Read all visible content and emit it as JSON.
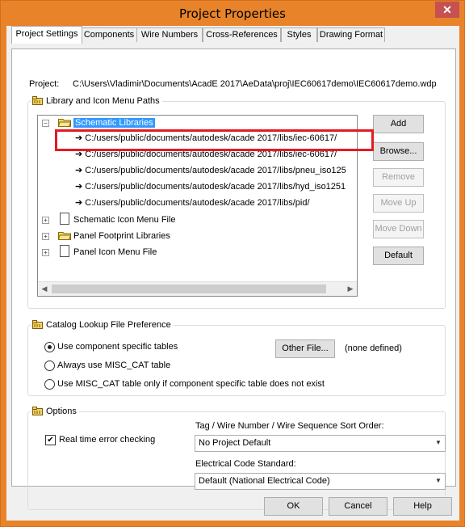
{
  "window": {
    "title": "Project Properties",
    "close_glyph": "✕"
  },
  "tabs": [
    "Project Settings",
    "Components",
    "Wire Numbers",
    "Cross-References",
    "Styles",
    "Drawing Format"
  ],
  "project": {
    "label": "Project:",
    "path": "C:\\Users\\Vladimir\\Documents\\AcadE 2017\\AeData\\proj\\IEC60617demo\\IEC60617demo.wdp"
  },
  "library_group": {
    "title": "Library and Icon Menu Paths",
    "tree": {
      "root": "Schematic Libraries",
      "paths": [
        "C:/users/public/documents/autodesk/acade 2017/libs/iec-60617/",
        "C:/users/public/documents/autodesk/acade 2017/libs/iec-60617/",
        "C:/users/public/documents/autodesk/acade 2017/libs/pneu_iso125",
        "C:/users/public/documents/autodesk/acade 2017/libs/hyd_iso1251",
        "C:/users/public/documents/autodesk/acade 2017/libs/pid/"
      ],
      "others": [
        "Schematic Icon Menu File",
        "Panel Footprint Libraries",
        "Panel Icon Menu File"
      ]
    },
    "buttons": {
      "add": "Add",
      "browse": "Browse...",
      "remove": "Remove",
      "move_up": "Move Up",
      "move_down": "Move Down",
      "default": "Default"
    }
  },
  "catalog_group": {
    "title": "Catalog Lookup File Preference",
    "options": [
      "Use component specific tables",
      "Always use MISC_CAT table",
      "Use MISC_CAT table only if component specific table does not exist"
    ],
    "selected_index": 0,
    "other_file": "Other File...",
    "other_file_status": "(none defined)"
  },
  "options_group": {
    "title": "Options",
    "realtime_label": "Real time error checking",
    "realtime_checked": true,
    "sort_label": "Tag / Wire Number / Wire Sequence Sort Order:",
    "sort_value": "No Project Default",
    "standard_label": "Electrical Code Standard:",
    "standard_value": "Default (National Electrical Code)"
  },
  "footer": {
    "ok": "OK",
    "cancel": "Cancel",
    "help": "Help"
  },
  "colors": {
    "title_bar": "#e8832a",
    "highlight": "#e31b23",
    "selection": "#3399ff"
  }
}
